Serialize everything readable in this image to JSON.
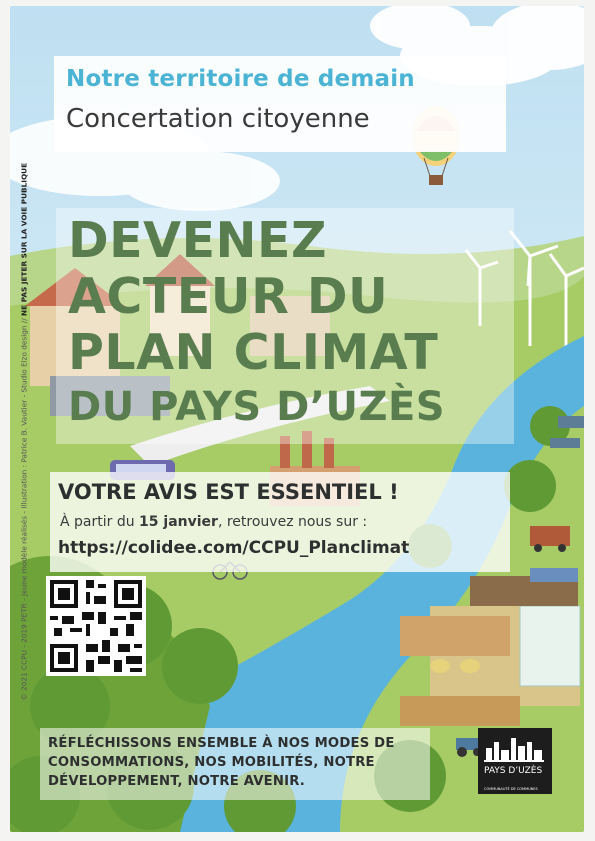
{
  "header": {
    "title": "Notre territoire de demain",
    "subtitle": "Concertation citoyenne"
  },
  "headline": {
    "line1": "DEVENEZ",
    "line2": "ACTEUR DU",
    "line3": "PLAN CLIMAT",
    "line4": "DU PAYS D’UZÈS"
  },
  "callout": {
    "title": "VOTRE AVIS EST ESSENTIEL !",
    "line_before": "À partir du",
    "date": "15 janvier",
    "line_after": ", retrouvez nous sur :",
    "url": "https://colidee.com/CCPU_Planclimat"
  },
  "footer_text": "RÉFLÉCHISSONS ENSEMBLE À NOS MODES DE CONSOMMATIONS, NOS MOBILITÉS, NOTRE DÉVELOPPEMENT, NOTRE AVENIR.",
  "logo": {
    "name": "PAYS D’UZÈS",
    "subtitle": "COMMUNAUTÉ DE COMMUNES"
  },
  "side_credit": {
    "text": "© 2021 CCPU - 2019 PETR - Jeune modèle réalisés - Illustration : Patrice B. Vautier - Studio Elzo design //",
    "warning": "NE PAS JETER SUR LA VOIE PUBLIQUE"
  },
  "colors": {
    "sky": "#cfe7f4",
    "title_blue": "#4bb3d4",
    "headline_green": "#5a7d4f",
    "river": "#59b3dd",
    "grass": "#a7cc66"
  }
}
